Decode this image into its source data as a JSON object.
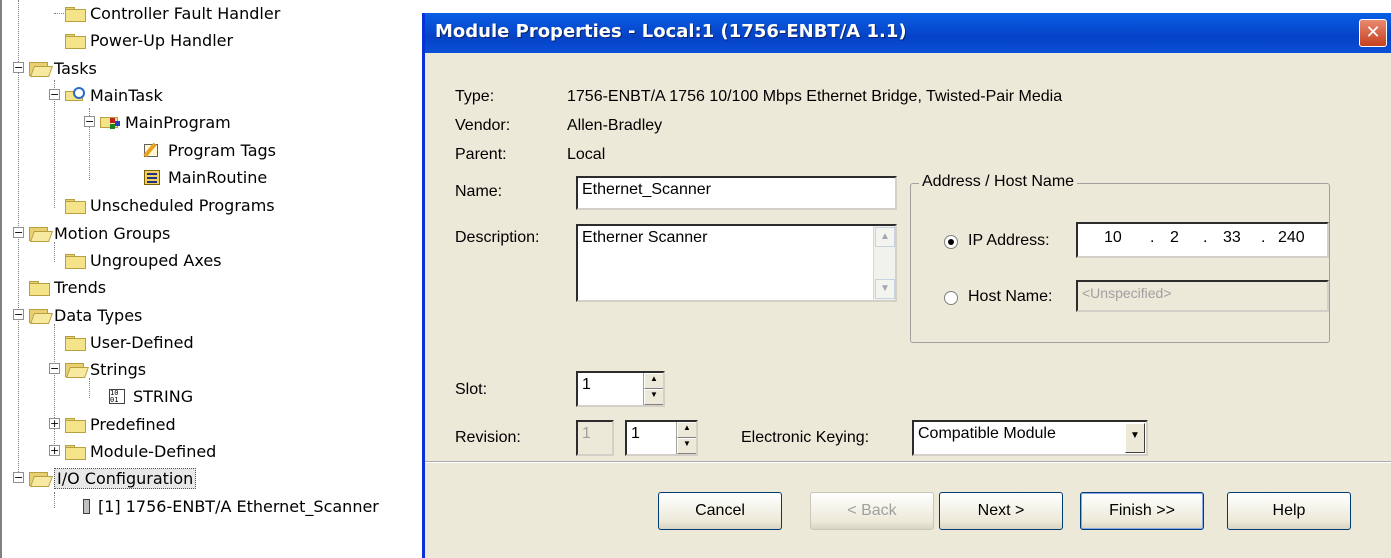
{
  "tree": {
    "items": [
      {
        "label": "Controller Fault Handler",
        "icon": "folder-closed-icon"
      },
      {
        "label": "Power-Up Handler",
        "icon": "folder-closed-icon"
      },
      {
        "label": "Tasks",
        "icon": "folder-open-icon",
        "expander": "−"
      },
      {
        "label": "MainTask",
        "icon": "task-icon",
        "expander": "−"
      },
      {
        "label": "MainProgram",
        "icon": "program-icon",
        "expander": "−"
      },
      {
        "label": "Program Tags",
        "icon": "program-tags-icon"
      },
      {
        "label": "MainRoutine",
        "icon": "routine-icon"
      },
      {
        "label": "Unscheduled Programs",
        "icon": "folder-closed-icon"
      },
      {
        "label": "Motion Groups",
        "icon": "folder-open-icon",
        "expander": "−"
      },
      {
        "label": "Ungrouped Axes",
        "icon": "folder-closed-icon"
      },
      {
        "label": "Trends",
        "icon": "folder-closed-icon"
      },
      {
        "label": "Data Types",
        "icon": "folder-open-icon",
        "expander": "−"
      },
      {
        "label": "User-Defined",
        "icon": "datatype-folder-icon"
      },
      {
        "label": "Strings",
        "icon": "datatype-folder-icon",
        "expander": "−"
      },
      {
        "label": "STRING",
        "icon": "string-type-icon"
      },
      {
        "label": "Predefined",
        "icon": "datatype-folder-icon",
        "expander": "+"
      },
      {
        "label": "Module-Defined",
        "icon": "datatype-folder-icon",
        "expander": "+"
      },
      {
        "label": "I/O Configuration",
        "icon": "folder-open-icon",
        "expander": "−"
      },
      {
        "label": "[1] 1756-ENBT/A Ethernet_Scanner",
        "icon": "module-icon"
      }
    ]
  },
  "dialog": {
    "title": "Module Properties - Local:1 (1756-ENBT/A 1.1)",
    "close_glyph": "✕",
    "type_label": "Type:",
    "type_value": "1756-ENBT/A 1756 10/100 Mbps Ethernet Bridge, Twisted-Pair Media",
    "vendor_label": "Vendor:",
    "vendor_value": "Allen-Bradley",
    "parent_label": "Parent:",
    "parent_value": "Local",
    "name_label": "Name:",
    "name_value": "Ethernet_Scanner",
    "description_label": "Description:",
    "description_value": "Etherner Scanner",
    "address_group_label": "Address / Host Name",
    "ip_address_label": "IP Address:",
    "ip_octets": [
      "10",
      "2",
      "33",
      "240"
    ],
    "ip_separator": ".",
    "host_name_label": "Host Name:",
    "host_name_placeholder": "<Unspecified>",
    "address_mode": "ip",
    "slot_label": "Slot:",
    "slot_value": "1",
    "revision_label": "Revision:",
    "revision_major": "1",
    "revision_minor": "1",
    "keying_label": "Electronic Keying:",
    "keying_value": "Compatible Module",
    "buttons": {
      "cancel": "Cancel",
      "back": "< Back",
      "next": "Next >",
      "finish": "Finish >>",
      "help": "Help"
    }
  }
}
